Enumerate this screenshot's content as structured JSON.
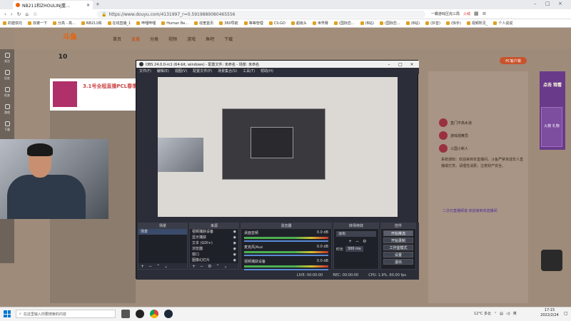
{
  "browser": {
    "tab_title": "NB211和ZHOULINJ重...",
    "url": "https://www.douyu.com/4131997_r=0.5919889080465556",
    "right_label": "一霸游戏压完三局",
    "badge": "火绒",
    "bookmarks": [
      "的建依托",
      "双被一下",
      "分高 - 高...",
      "NB211和",
      "在线直播_1",
      "哔哩哔哩",
      "Human Be...",
      "动宽首页",
      "360导航",
      "等等管理",
      "CS:GO",
      "超级头",
      "世界赛",
      "(国际恋...",
      "(B站)",
      "(国际恋...",
      "(B站)",
      "(抖音)",
      "(快手)",
      "视频所见_",
      "个人说说"
    ]
  },
  "site": {
    "logo": "斗鱼",
    "nav": [
      "首页",
      "直播",
      "分类",
      "视频",
      "游戏",
      "鱼吧",
      "下载"
    ],
    "room_title": "3.1号全程直播PCL春季",
    "level_num": "10",
    "pc_button": "PC客户端",
    "left_items": [
      "关注",
      "历史",
      "任务",
      "游戏",
      "下载"
    ],
    "chat_rows": [
      "直门不高水道",
      "游戏观察员",
      "三国小新人"
    ],
    "chat_text": "系统通知：欢迎来到本直播间。斗鱼严禁未成年人直播或打赏。请理性消费，注意财产安全。",
    "chat_link": "二次元直播频道 欢迎来到本直播间",
    "promo": "点击 观看",
    "promo2": "火箭 礼物"
  },
  "obs": {
    "title": "OBS 24.0.0-rc1 (64-bit, windows) - 配置文件: 未命名 - 场景: 未命名",
    "menu": [
      "文件(F)",
      "编辑(E)",
      "视图(V)",
      "配置文件(P)",
      "场景集合(S)",
      "工具(T)",
      "帮助(H)"
    ],
    "docks": {
      "scenes": {
        "header": "场景",
        "items": [
          "场景"
        ]
      },
      "sources": {
        "header": "来源",
        "items": [
          "视频捕获设备",
          "显示捕获",
          "文本 (GDI+)",
          "浏览器",
          "窗口",
          "图像幻灯片"
        ]
      },
      "mixer": {
        "header": "混音器",
        "items": [
          {
            "name": "桌面音频",
            "db": "0.0 dB"
          },
          {
            "name": "麦克风/Aux",
            "db": "0.0 dB"
          },
          {
            "name": "视频捕获设备",
            "db": "0.0 dB"
          }
        ]
      },
      "transitions": {
        "header": "转场特效",
        "type": "淡出",
        "duration_label": "时长",
        "duration": "300 ms"
      },
      "controls": {
        "header": "控件",
        "buttons": [
          "开始推流",
          "开始录制",
          "工作室模式",
          "设置",
          "退出"
        ]
      }
    },
    "status": {
      "live": "LIVE: 00:00:00",
      "rec": "REC: 00:00:00",
      "cpu": "CPU: 1.9%, 60.00 fps"
    }
  },
  "taskbar": {
    "search_placeholder": "在这里输入你要搜索的内容",
    "weather": "12°C 多云",
    "ime": "英",
    "time": "17:15",
    "date": "2022/2/24"
  }
}
